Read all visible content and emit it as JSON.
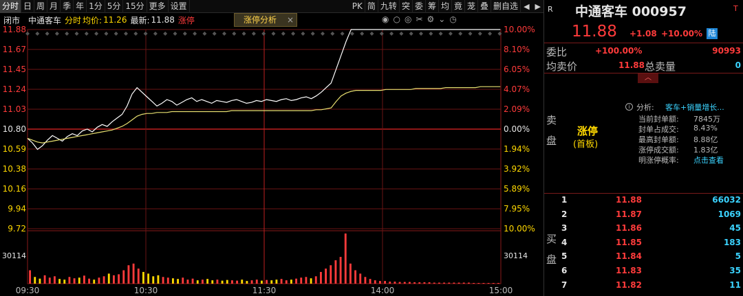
{
  "toolbar": {
    "left_tabs": [
      "分时",
      "日",
      "周",
      "月",
      "季",
      "年",
      "1分",
      "5分",
      "15分",
      "更多",
      "设置"
    ],
    "active_tab": "分时",
    "right_tabs": [
      "PK",
      "简",
      "九转",
      "突",
      "委",
      "筹",
      "均",
      "竟",
      "茏",
      "叠",
      "删自选"
    ]
  },
  "infobar": {
    "status": "闭市",
    "name": "中通客车",
    "label_fs": "分时",
    "avg_label": "均价:",
    "avg_value": "11.26",
    "latest_label": "最新:",
    "latest_value": "11.88",
    "zt_prefix": "涨停",
    "tab_label": "涨停分析",
    "tab_close": "×"
  },
  "chart_data": {
    "type": "line",
    "title": "",
    "prev_close": 10.8,
    "ylim": [
      9.72,
      11.88
    ],
    "price_ticks": [
      "11.88",
      "11.67",
      "11.45",
      "11.24",
      "11.03",
      "10.80",
      "10.59",
      "10.38",
      "10.16",
      "9.94",
      "9.72"
    ],
    "pct_ticks": [
      "10.00%",
      "8.10%",
      "6.05%",
      "4.07%",
      "2.09%",
      "0.00%",
      "1.94%",
      "3.92%",
      "5.89%",
      "7.95%",
      "10.00%"
    ],
    "volume_tick": "30114",
    "x_ticks": [
      "09:30",
      "10:30",
      "11:30",
      "14:00",
      "15:00"
    ],
    "series": [
      {
        "name": "",
        "color": "#ffffff",
        "values": [
          10.7,
          10.65,
          10.58,
          10.62,
          10.68,
          10.73,
          10.7,
          10.67,
          10.72,
          10.75,
          10.73,
          10.78,
          10.8,
          10.77,
          10.82,
          10.85,
          10.83,
          10.88,
          10.92,
          10.96,
          11.05,
          11.18,
          11.25,
          11.2,
          11.15,
          11.1,
          11.05,
          11.08,
          11.12,
          11.1,
          11.06,
          11.09,
          11.12,
          11.14,
          11.1,
          11.12,
          11.1,
          11.08,
          11.11,
          11.1,
          11.09,
          11.11,
          11.12,
          11.1,
          11.08,
          11.09,
          11.11,
          11.1,
          11.12,
          11.11,
          11.1,
          11.12,
          11.13,
          11.11,
          11.12,
          11.14,
          11.15,
          11.13,
          11.16,
          11.2,
          11.25,
          11.3,
          11.45,
          11.6,
          11.75,
          11.88,
          11.88,
          11.88,
          11.88,
          11.88,
          11.88,
          11.88,
          11.88,
          11.88,
          11.88,
          11.88,
          11.88,
          11.88,
          11.88,
          11.88,
          11.88,
          11.88,
          11.88,
          11.88,
          11.88,
          11.88,
          11.88,
          11.88,
          11.88,
          11.88,
          11.88,
          11.88,
          11.88,
          11.88,
          11.88,
          11.88
        ]
      },
      {
        "name": "",
        "color": "#e8e070",
        "values": [
          10.7,
          10.68,
          10.66,
          10.65,
          10.66,
          10.67,
          10.68,
          10.69,
          10.7,
          10.71,
          10.72,
          10.73,
          10.74,
          10.75,
          10.76,
          10.77,
          10.78,
          10.79,
          10.81,
          10.83,
          10.86,
          10.9,
          10.94,
          10.96,
          10.97,
          10.97,
          10.98,
          10.98,
          10.98,
          10.99,
          10.99,
          10.99,
          10.99,
          10.99,
          10.99,
          10.99,
          10.99,
          10.99,
          10.99,
          10.99,
          10.99,
          11.0,
          11.0,
          11.0,
          11.0,
          11.0,
          11.0,
          11.0,
          11.0,
          11.0,
          11.0,
          11.0,
          11.0,
          11.0,
          11.0,
          11.0,
          11.0,
          11.0,
          11.01,
          11.01,
          11.02,
          11.03,
          11.1,
          11.16,
          11.19,
          11.21,
          11.22,
          11.22,
          11.22,
          11.22,
          11.22,
          11.22,
          11.23,
          11.23,
          11.23,
          11.23,
          11.23,
          11.23,
          11.24,
          11.24,
          11.24,
          11.24,
          11.24,
          11.24,
          11.25,
          11.25,
          11.25,
          11.25,
          11.25,
          11.25,
          11.25,
          11.26,
          11.26,
          11.26,
          11.26,
          11.26
        ]
      }
    ],
    "volume": [
      40,
      20,
      15,
      25,
      18,
      22,
      14,
      12,
      20,
      16,
      18,
      24,
      15,
      12,
      18,
      22,
      30,
      25,
      28,
      40,
      55,
      60,
      45,
      35,
      30,
      22,
      25,
      20,
      18,
      16,
      14,
      18,
      12,
      15,
      10,
      12,
      14,
      10,
      12,
      9,
      11,
      10,
      9,
      12,
      8,
      10,
      12,
      9,
      11,
      10,
      12,
      14,
      10,
      12,
      15,
      18,
      20,
      16,
      22,
      35,
      45,
      55,
      70,
      80,
      150,
      60,
      40,
      30,
      20,
      14,
      10,
      8,
      8,
      6,
      6,
      5,
      5,
      5,
      4,
      4,
      4,
      4,
      3,
      3,
      3,
      3,
      3,
      3,
      3,
      3,
      2,
      2,
      2,
      2,
      2,
      2
    ],
    "colors": {
      "up": "#ff3b3b",
      "down": "#ffd800",
      "grid": "#8a1a1a"
    }
  },
  "panel": {
    "logo": "R",
    "name": "中通客车 000957",
    "t_mark": "T",
    "price": "11.88",
    "change": "+1.08",
    "pct": "+10.00%",
    "badge": "陆",
    "weibi_label": "委比",
    "weibi_value": "+100.00%",
    "weibi_qty": "90993",
    "junmai_label": "均卖价",
    "junmai_value": "11.88",
    "zmai_label": "总卖量",
    "zmai_value": "0",
    "sell_label": "卖盘",
    "zt_title": "涨停",
    "zt_sub": "(首板)",
    "analysis_label": "分析:",
    "analysis_text": "客车+销量增长...",
    "stats": [
      {
        "k": "当前封单额:",
        "v": "7845万"
      },
      {
        "k": "封单占成交:",
        "v": "8.43%"
      },
      {
        "k": "最高封单额:",
        "v": "8.88亿"
      },
      {
        "k": "涨停成交额:",
        "v": "1.83亿"
      },
      {
        "k": "明涨停概率:",
        "v": "点击查看"
      }
    ],
    "buy_label": "买盘",
    "buy": [
      {
        "n": "1",
        "p": "11.88",
        "q": "66032"
      },
      {
        "n": "2",
        "p": "11.87",
        "q": "1069"
      },
      {
        "n": "3",
        "p": "11.86",
        "q": "45"
      },
      {
        "n": "4",
        "p": "11.85",
        "q": "183"
      },
      {
        "n": "5",
        "p": "11.84",
        "q": "5"
      },
      {
        "n": "6",
        "p": "11.83",
        "q": "35"
      },
      {
        "n": "7",
        "p": "11.82",
        "q": "11"
      }
    ]
  }
}
